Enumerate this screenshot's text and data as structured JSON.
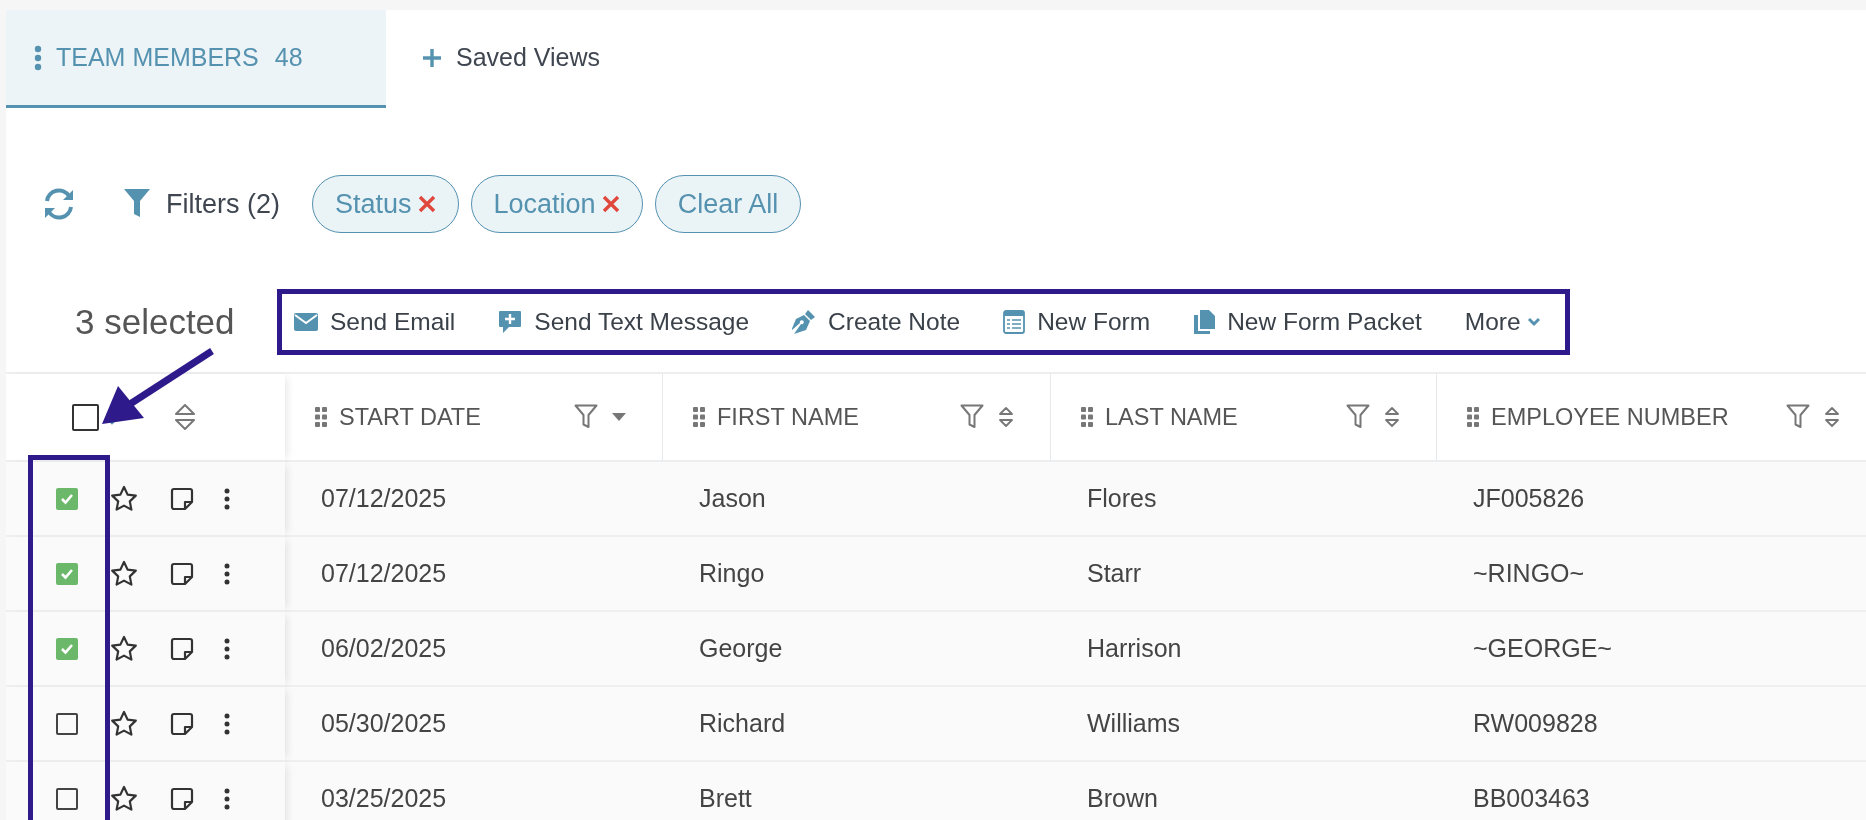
{
  "tabs": [
    {
      "kind": "view",
      "label": "TEAM MEMBERS",
      "count": "48",
      "selected": true
    },
    {
      "kind": "add",
      "label": "Saved Views",
      "selected": false
    }
  ],
  "filters": {
    "label": "Filters (2)",
    "chips": [
      {
        "label": "Status",
        "removable": true
      },
      {
        "label": "Location",
        "removable": true
      },
      {
        "label": "Clear All",
        "removable": false
      }
    ]
  },
  "selection": {
    "label": "3 selected",
    "actions": [
      {
        "kind": "email",
        "label": "Send Email"
      },
      {
        "kind": "sms",
        "label": "Send Text Message"
      },
      {
        "kind": "note",
        "label": "Create Note"
      },
      {
        "kind": "form",
        "label": "New Form"
      },
      {
        "kind": "packet",
        "label": "New Form Packet"
      },
      {
        "kind": "more",
        "label": "More"
      }
    ]
  },
  "table": {
    "select_all": {
      "checked": false
    },
    "columns": [
      {
        "label": "START DATE",
        "sorted": true
      },
      {
        "label": "FIRST NAME",
        "sorted": false
      },
      {
        "label": "LAST NAME",
        "sorted": false
      },
      {
        "label": "EMPLOYEE NUMBER",
        "sorted": false
      }
    ],
    "rows": [
      {
        "checked": true,
        "starred": false,
        "cells": [
          "07/12/2025",
          "Jason",
          "Flores",
          "JF005826"
        ]
      },
      {
        "checked": true,
        "starred": false,
        "cells": [
          "07/12/2025",
          "Ringo",
          "Starr",
          "~RINGO~"
        ]
      },
      {
        "checked": true,
        "starred": false,
        "cells": [
          "06/02/2025",
          "George",
          "Harrison",
          "~GEORGE~"
        ]
      },
      {
        "checked": false,
        "starred": false,
        "cells": [
          "05/30/2025",
          "Richard",
          "Williams",
          "RW009828"
        ]
      },
      {
        "checked": false,
        "starred": false,
        "cells": [
          "03/25/2025",
          "Brett",
          "Brown",
          "BB003463"
        ]
      }
    ]
  }
}
